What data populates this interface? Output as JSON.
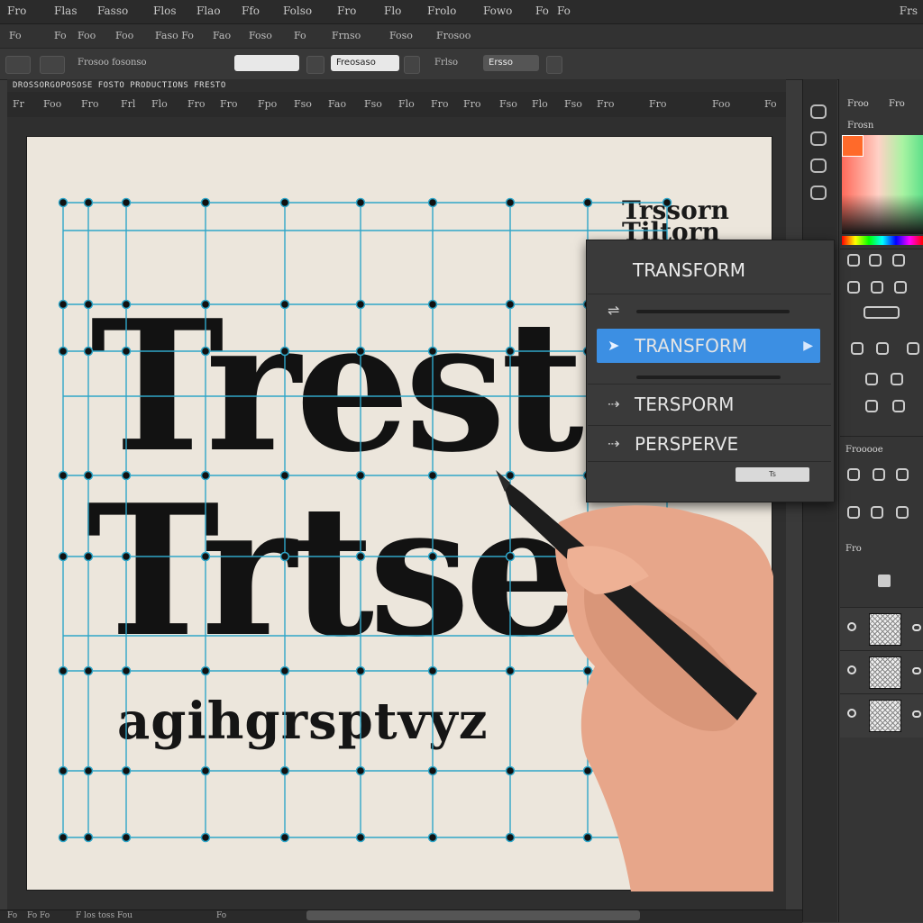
{
  "menubar": {
    "items": [
      "Fro",
      "Flas",
      "Fasso",
      "Flos",
      "Flao",
      "Ffo",
      "Folso",
      "Fro",
      "Flo",
      "Frolo",
      "Fowo",
      "Fo",
      "Fo"
    ],
    "corner": "Frs"
  },
  "toolbar2": {
    "items": [
      "Fo",
      "Fo",
      "Foo",
      "Foo",
      "Faso Fo",
      "Fao",
      "Foso",
      "Fo",
      "Frnso",
      "Foso",
      "Frosoo"
    ]
  },
  "options": {
    "left_label": "Frosoo fosonso",
    "zoom_value": "",
    "field_text": "Freosaso",
    "right_label": "Frlso",
    "preset": "Ersso"
  },
  "document": {
    "tab_title": "DROSSORGOPOSOSE FOSTO PRODUCTIONS FRESTO",
    "ruler_labels": [
      "Fr",
      "Foo",
      "Fro",
      "Frl",
      "Flo",
      "Fro",
      "Fro",
      "Fpo",
      "Fso",
      "Fao",
      "Fso",
      "Flo",
      "Fro",
      "Fro",
      "Fso",
      "Flo",
      "Fso",
      "Fro",
      "Fro",
      "Foo",
      "Fo"
    ]
  },
  "canvas": {
    "heading_line1": "Trest",
    "heading_line2": "Trtseu",
    "alphabet_line": "agihgrsptvyz",
    "corner_word_line1": "Trssorn",
    "corner_word_line2": "Tiltorn"
  },
  "transform_menu": {
    "title": "TRANSFORM",
    "items": [
      {
        "label": "",
        "icon": "sliders-icon"
      },
      {
        "label": "TRANSFORM",
        "icon": "arrow-icon",
        "selected": true
      },
      {
        "label": "TERSPORM",
        "icon": "distort-icon"
      },
      {
        "label": "PERSPERVE",
        "icon": "perspective-icon"
      }
    ],
    "button_text": "Ts"
  },
  "right_panel": {
    "tabs": [
      "Froo",
      "Fro"
    ],
    "subtab": "Frosn",
    "section_label": "Frooooe",
    "section_label2": "Fro"
  },
  "colors": {
    "accent": "#3c8fe3",
    "grid_line": "#2fa6c8",
    "swatch": "#ff6a2a"
  },
  "status": {
    "zoom": "Fo",
    "info": "Fo Fo",
    "doc": "F los toss Fou",
    "right": "Fo"
  }
}
